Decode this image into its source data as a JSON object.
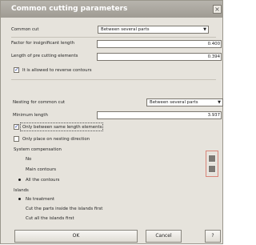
{
  "dialog": {
    "title": "Common cutting parameters",
    "close_symbol": "×"
  },
  "common_cut": {
    "label": "Common cut",
    "value": "Between several parts"
  },
  "factor_insignificant_length": {
    "label": "Factor for insignificant length",
    "value": "0.400"
  },
  "length_precutting": {
    "label": "Length of pre cutting elements",
    "value": "0.394"
  },
  "reverse_contours": {
    "label": "It is allowed to reverse contours",
    "checked": true,
    "check_symbol": "✓"
  },
  "nesting_common_cut": {
    "label": "Nesting for common cut",
    "value": "Between several parts"
  },
  "minimum_length": {
    "label": "Minimum length",
    "value": "3.937"
  },
  "same_length_elements": {
    "label": "Only between same length elements",
    "checked": true,
    "check_symbol": "✓"
  },
  "nesting_direction": {
    "label": "Only place on nesting direction",
    "checked": false
  },
  "system_compensation": {
    "label": "System compensation",
    "options": [
      {
        "label": "No",
        "selected": false
      },
      {
        "label": "Main contours",
        "selected": false
      },
      {
        "label": "All the contours",
        "selected": true
      }
    ]
  },
  "islands": {
    "label": "Islands",
    "options": [
      {
        "label": "No treatment",
        "selected": true
      },
      {
        "label": "Cut the parts inside the islands first",
        "selected": false
      },
      {
        "label": "Cut all the islands first",
        "selected": false
      }
    ]
  },
  "buttons": {
    "ok": "OK",
    "cancel": "Cancel",
    "help": "?"
  },
  "colors": {
    "title_bar": "#a9a59e",
    "dialog_background": "#e6e3dc",
    "check_mark": "#3048a8"
  }
}
